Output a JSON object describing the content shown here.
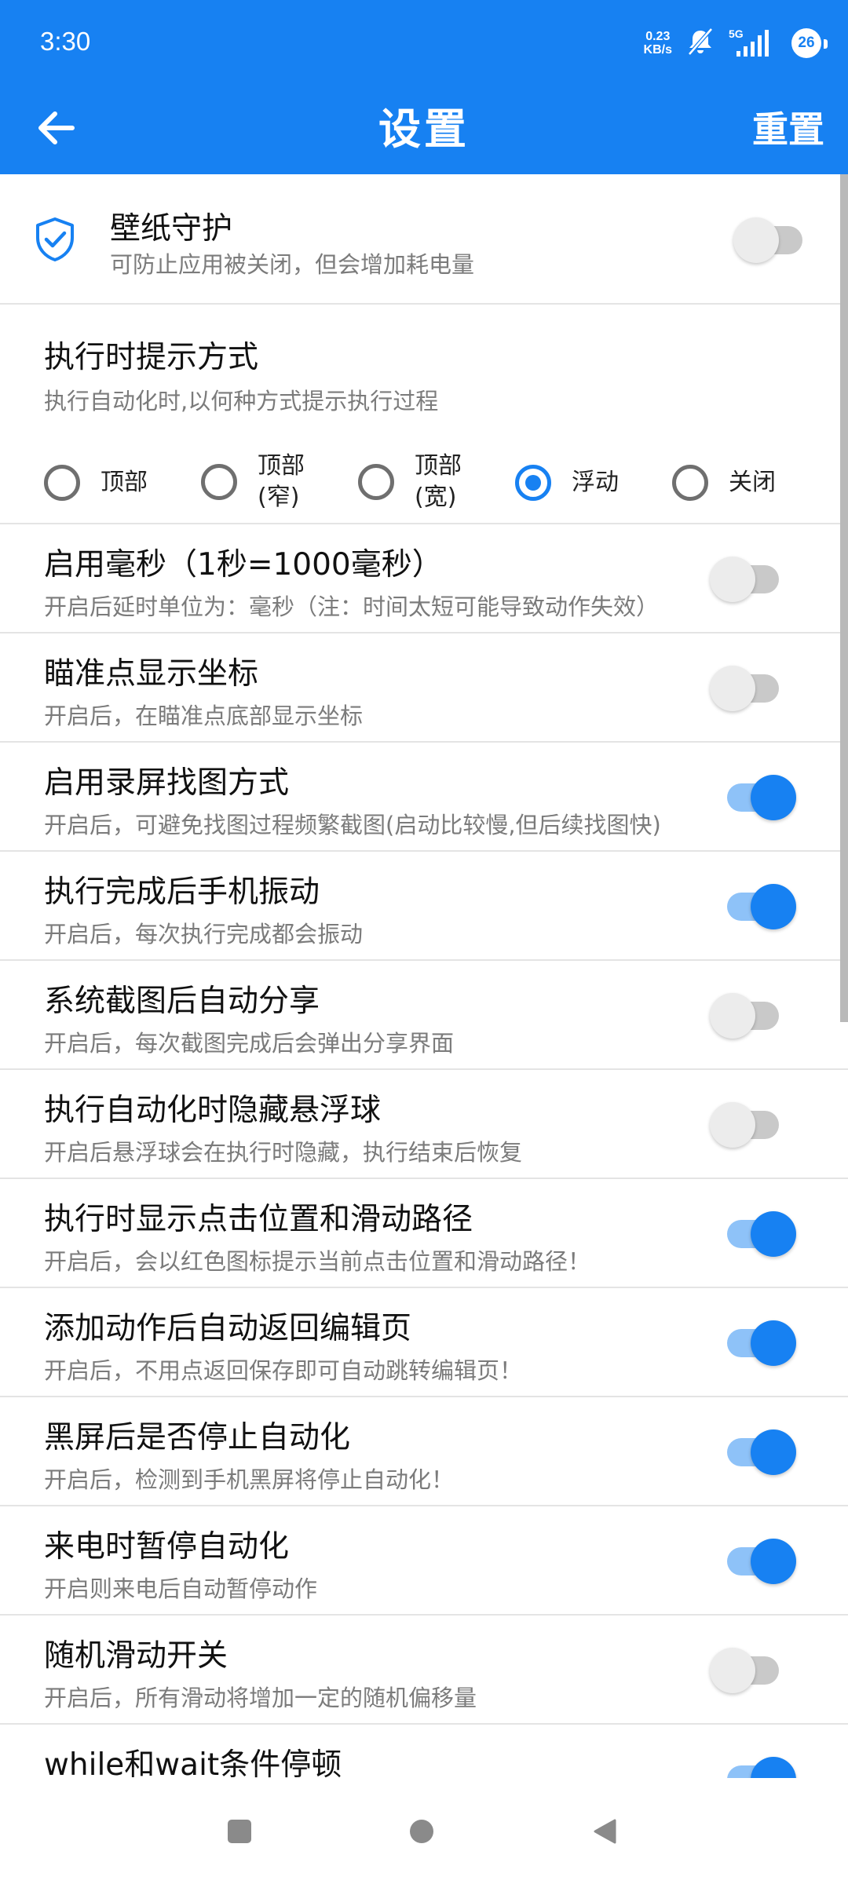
{
  "status_bar": {
    "time": "3:30",
    "net_speed_value": "0.23",
    "net_speed_unit": "KB/s",
    "signal_label": "5G",
    "battery": "26"
  },
  "app_bar": {
    "title": "设置",
    "reset_label": "重置"
  },
  "wallpaper_guard": {
    "title": "壁纸守护",
    "desc": "可防止应用被关闭，但会增加耗电量",
    "on": false
  },
  "prompt_mode": {
    "title": "执行时提示方式",
    "desc": "执行自动化时,以何种方式提示执行过程",
    "options": [
      "顶部",
      "顶部\n(窄)",
      "顶部\n(宽)",
      "浮动",
      "关闭"
    ],
    "selected": "浮动"
  },
  "settings": [
    {
      "title": "启用毫秒（1秒=1000毫秒）",
      "desc": "开启后延时单位为：毫秒（注：时间太短可能导致动作失效）",
      "on": false
    },
    {
      "title": "瞄准点显示坐标",
      "desc": "开启后，在瞄准点底部显示坐标",
      "on": false
    },
    {
      "title": "启用录屏找图方式",
      "desc": "开启后，可避免找图过程频繁截图(启动比较慢,但后续找图快)",
      "on": true
    },
    {
      "title": "执行完成后手机振动",
      "desc": "开启后，每次执行完成都会振动",
      "on": true
    },
    {
      "title": "系统截图后自动分享",
      "desc": "开启后，每次截图完成后会弹出分享界面",
      "on": false
    },
    {
      "title": "执行自动化时隐藏悬浮球",
      "desc": "开启后悬浮球会在执行时隐藏，执行结束后恢复",
      "on": false
    },
    {
      "title": "执行时显示点击位置和滑动路径",
      "desc": "开启后，会以红色图标提示当前点击位置和滑动路径！",
      "on": true
    },
    {
      "title": "添加动作后自动返回编辑页",
      "desc": "开启后，不用点返回保存即可自动跳转编辑页！",
      "on": true
    },
    {
      "title": "黑屏后是否停止自动化",
      "desc": "开启后，检测到手机黑屏将停止自动化！",
      "on": true
    },
    {
      "title": "来电时暂停自动化",
      "desc": "开启则来电后自动暂停动作",
      "on": true
    },
    {
      "title": "随机滑动开关",
      "desc": "开启后，所有滑动将增加一定的随机偏移量",
      "on": false
    },
    {
      "title": "while和wait条件停顿",
      "desc": "",
      "on": true
    }
  ],
  "colors": {
    "accent": "#1781f2",
    "divider": "#e4e4e4",
    "desc_text": "#7b7b7b"
  },
  "icons": {
    "back": "arrow-left-icon",
    "shield": "shield-check-icon",
    "nav_recent": "square-icon",
    "nav_home": "circle-icon",
    "nav_back": "triangle-back-icon"
  }
}
